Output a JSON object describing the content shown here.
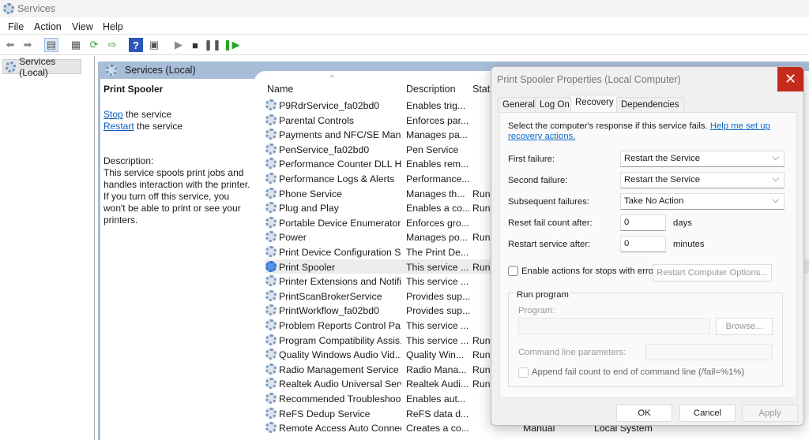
{
  "window": {
    "title": "Services"
  },
  "menu": [
    "File",
    "Action",
    "View",
    "Help"
  ],
  "tree": {
    "root": "Services (Local)"
  },
  "header": {
    "title": "Services (Local)"
  },
  "detail": {
    "service_name": "Print Spooler",
    "stop_link": "Stop",
    "stop_rest": " the service",
    "restart_link": "Restart",
    "restart_rest": " the service",
    "desc_label": "Description:",
    "description": "This service spools print jobs and handles interaction with the printer. If you turn off this service, you won't be able to print or see your printers."
  },
  "columns": {
    "name": "Name",
    "description": "Description",
    "status": "Statu"
  },
  "services": [
    {
      "name": "P9RdrService_fa02bd0",
      "desc": "Enables trig...",
      "status": ""
    },
    {
      "name": "Parental Controls",
      "desc": "Enforces par...",
      "status": ""
    },
    {
      "name": "Payments and NFC/SE Mana...",
      "desc": "Manages pa...",
      "status": ""
    },
    {
      "name": "PenService_fa02bd0",
      "desc": "Pen Service",
      "status": ""
    },
    {
      "name": "Performance Counter DLL H...",
      "desc": "Enables rem...",
      "status": ""
    },
    {
      "name": "Performance Logs & Alerts",
      "desc": "Performance...",
      "status": ""
    },
    {
      "name": "Phone Service",
      "desc": "Manages th...",
      "status": "Runı"
    },
    {
      "name": "Plug and Play",
      "desc": "Enables a co...",
      "status": "Runı"
    },
    {
      "name": "Portable Device Enumerator ...",
      "desc": "Enforces gro...",
      "status": ""
    },
    {
      "name": "Power",
      "desc": "Manages po...",
      "status": "Runı"
    },
    {
      "name": "Print Device Configuration S...",
      "desc": "The Print De...",
      "status": ""
    },
    {
      "name": "Print Spooler",
      "desc": "This service ...",
      "status": "Runı"
    },
    {
      "name": "Printer Extensions and Notifi...",
      "desc": "This service ...",
      "status": ""
    },
    {
      "name": "PrintScanBrokerService",
      "desc": "Provides sup...",
      "status": ""
    },
    {
      "name": "PrintWorkflow_fa02bd0",
      "desc": "Provides sup...",
      "status": ""
    },
    {
      "name": "Problem Reports Control Pa...",
      "desc": "This service ...",
      "status": ""
    },
    {
      "name": "Program Compatibility Assis...",
      "desc": "This service ...",
      "status": "Runı"
    },
    {
      "name": "Quality Windows Audio Vid...",
      "desc": "Quality Win...",
      "status": "Runı"
    },
    {
      "name": "Radio Management Service",
      "desc": "Radio Mana...",
      "status": "Runı"
    },
    {
      "name": "Realtek Audio Universal Serv...",
      "desc": "Realtek Audi...",
      "status": "Runı"
    },
    {
      "name": "Recommended Troubleshoo...",
      "desc": "Enables aut...",
      "status": ""
    },
    {
      "name": "ReFS Dedup Service",
      "desc": "ReFS data d...",
      "status": ""
    },
    {
      "name": "Remote Access Auto Connec...",
      "desc": "Creates a co...",
      "status": "",
      "startup": "Manual",
      "logon": "Local System"
    }
  ],
  "dialog": {
    "title": "Print Spooler Properties (Local Computer)",
    "tabs": [
      "General",
      "Log On",
      "Recovery",
      "Dependencies"
    ],
    "intro": "Select the computer's response if this service fails. ",
    "help_link": "Help me set up recovery actions.",
    "first_label": "First failure:",
    "first_value": "Restart the Service",
    "second_label": "Second failure:",
    "second_value": "Restart the Service",
    "subsequent_label": "Subsequent failures:",
    "subsequent_value": "Take No Action",
    "reset_label": "Reset fail count after:",
    "reset_value": "0",
    "reset_unit": "days",
    "restart_label": "Restart service after:",
    "restart_value": "0",
    "restart_unit": "minutes",
    "enable_actions": "Enable actions for stops with errors.",
    "restart_options": "Restart Computer Options...",
    "run_program": "Run program",
    "program_label": "Program:",
    "browse": "Browse...",
    "cmd_label": "Command line parameters:",
    "append": "Append fail count to end of command line (/fail=%1%)",
    "ok": "OK",
    "cancel": "Cancel",
    "apply": "Apply"
  }
}
